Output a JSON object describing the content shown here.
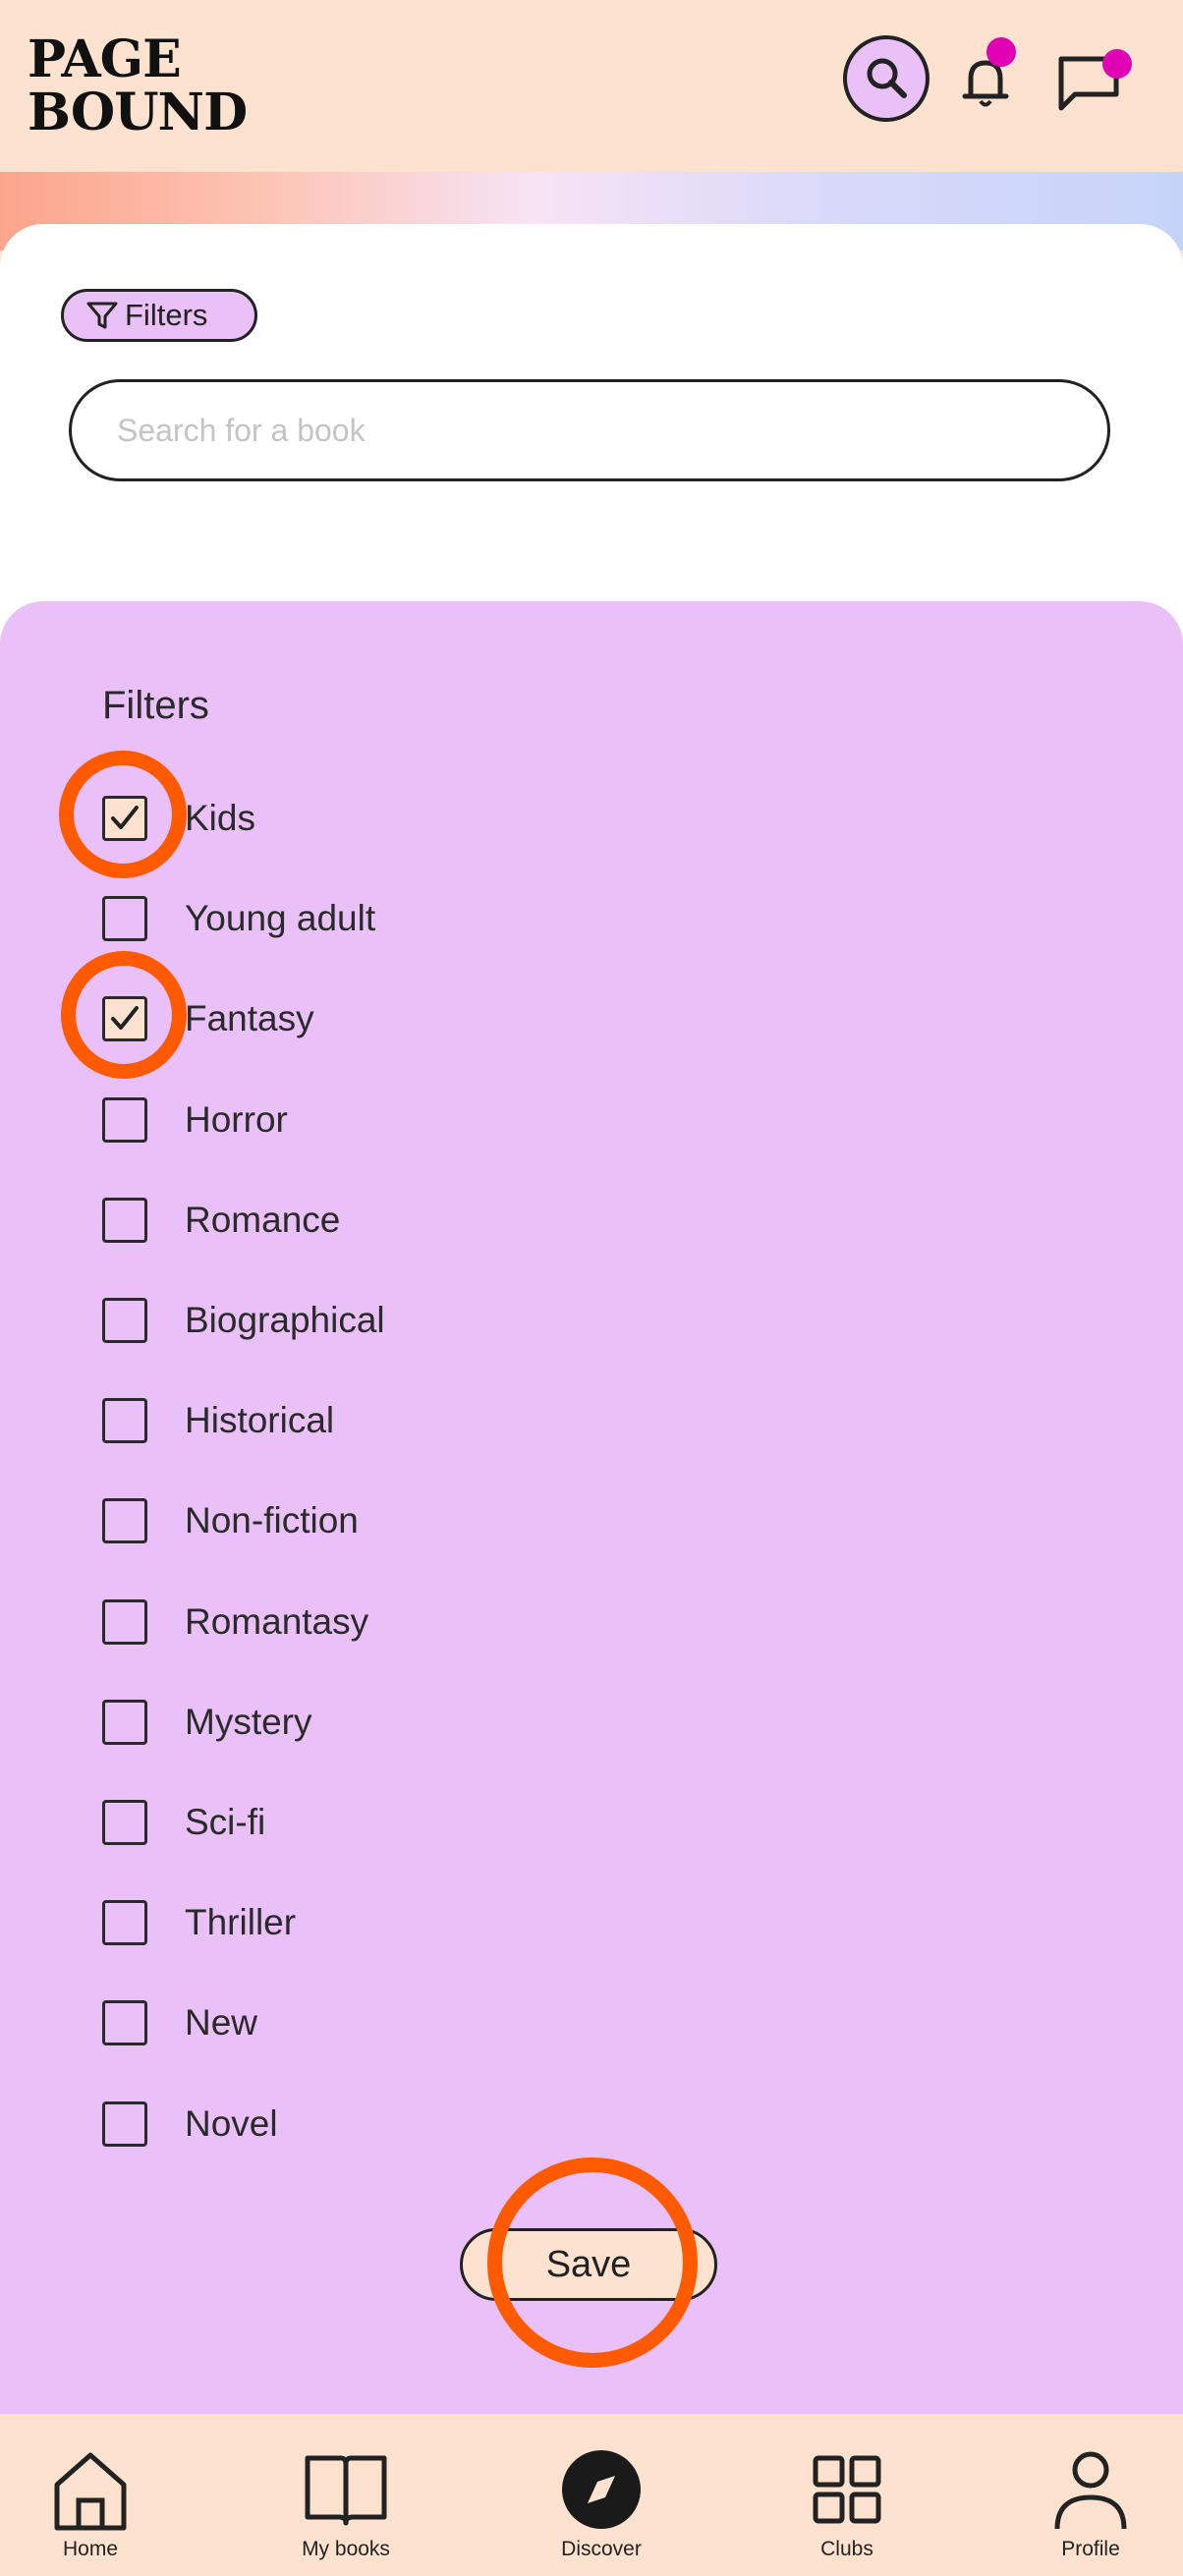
{
  "app": {
    "logo_line1": "PAGE",
    "logo_line2": "BOUND"
  },
  "header": {
    "search_icon": "search-icon",
    "notifications_icon": "bell-icon",
    "messages_icon": "chat-bubble-icon",
    "badge_color": "#e000b4"
  },
  "search": {
    "filter_chip_label": "Filters",
    "placeholder": "Search for a book",
    "value": ""
  },
  "filters": {
    "title": "Filters",
    "options": [
      {
        "label": "Kids",
        "checked": true
      },
      {
        "label": "Young adult",
        "checked": false
      },
      {
        "label": "Fantasy",
        "checked": true
      },
      {
        "label": "Horror",
        "checked": false
      },
      {
        "label": "Romance",
        "checked": false
      },
      {
        "label": "Biographical",
        "checked": false
      },
      {
        "label": "Historical",
        "checked": false
      },
      {
        "label": "Non-fiction",
        "checked": false
      },
      {
        "label": "Romantasy",
        "checked": false
      },
      {
        "label": "Mystery",
        "checked": false
      },
      {
        "label": "Sci-fi",
        "checked": false
      },
      {
        "label": "Thriller",
        "checked": false
      },
      {
        "label": "New",
        "checked": false
      },
      {
        "label": "Novel",
        "checked": false
      }
    ],
    "save_label": "Save"
  },
  "nav": {
    "items": [
      {
        "label": "Home",
        "icon": "home-icon"
      },
      {
        "label": "My books",
        "icon": "book-icon"
      },
      {
        "label": "Discover",
        "icon": "compass-icon",
        "active": true
      },
      {
        "label": "Clubs",
        "icon": "grid-icon"
      },
      {
        "label": "Profile",
        "icon": "person-icon"
      }
    ]
  },
  "colors": {
    "background": "#fde3cf",
    "panel": "#eac0f9",
    "accent_ring": "#ff5a00",
    "text": "#2a2a2a"
  }
}
